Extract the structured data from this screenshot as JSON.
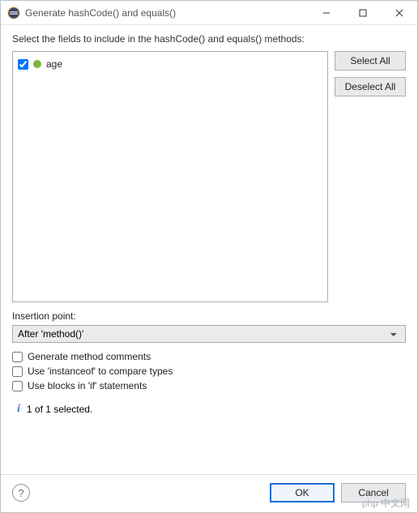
{
  "titlebar": {
    "title": "Generate hashCode() and equals()"
  },
  "instruction": "Select the fields to include in the hashCode() and equals() methods:",
  "fields": {
    "items": [
      {
        "label": "age",
        "checked": true
      }
    ]
  },
  "buttons": {
    "selectAll": "Select All",
    "deselectAll": "Deselect All",
    "ok": "OK",
    "cancel": "Cancel"
  },
  "insertion": {
    "label": "Insertion point:",
    "value": "After 'method()'"
  },
  "options": {
    "genComments": {
      "label": "Generate method comments",
      "checked": false
    },
    "useInstanceof": {
      "label": "Use 'instanceof' to compare types",
      "checked": false
    },
    "useBlocks": {
      "label": "Use blocks in 'if' statements",
      "checked": false
    }
  },
  "status": "1 of 1 selected.",
  "watermark": "php 中文网"
}
